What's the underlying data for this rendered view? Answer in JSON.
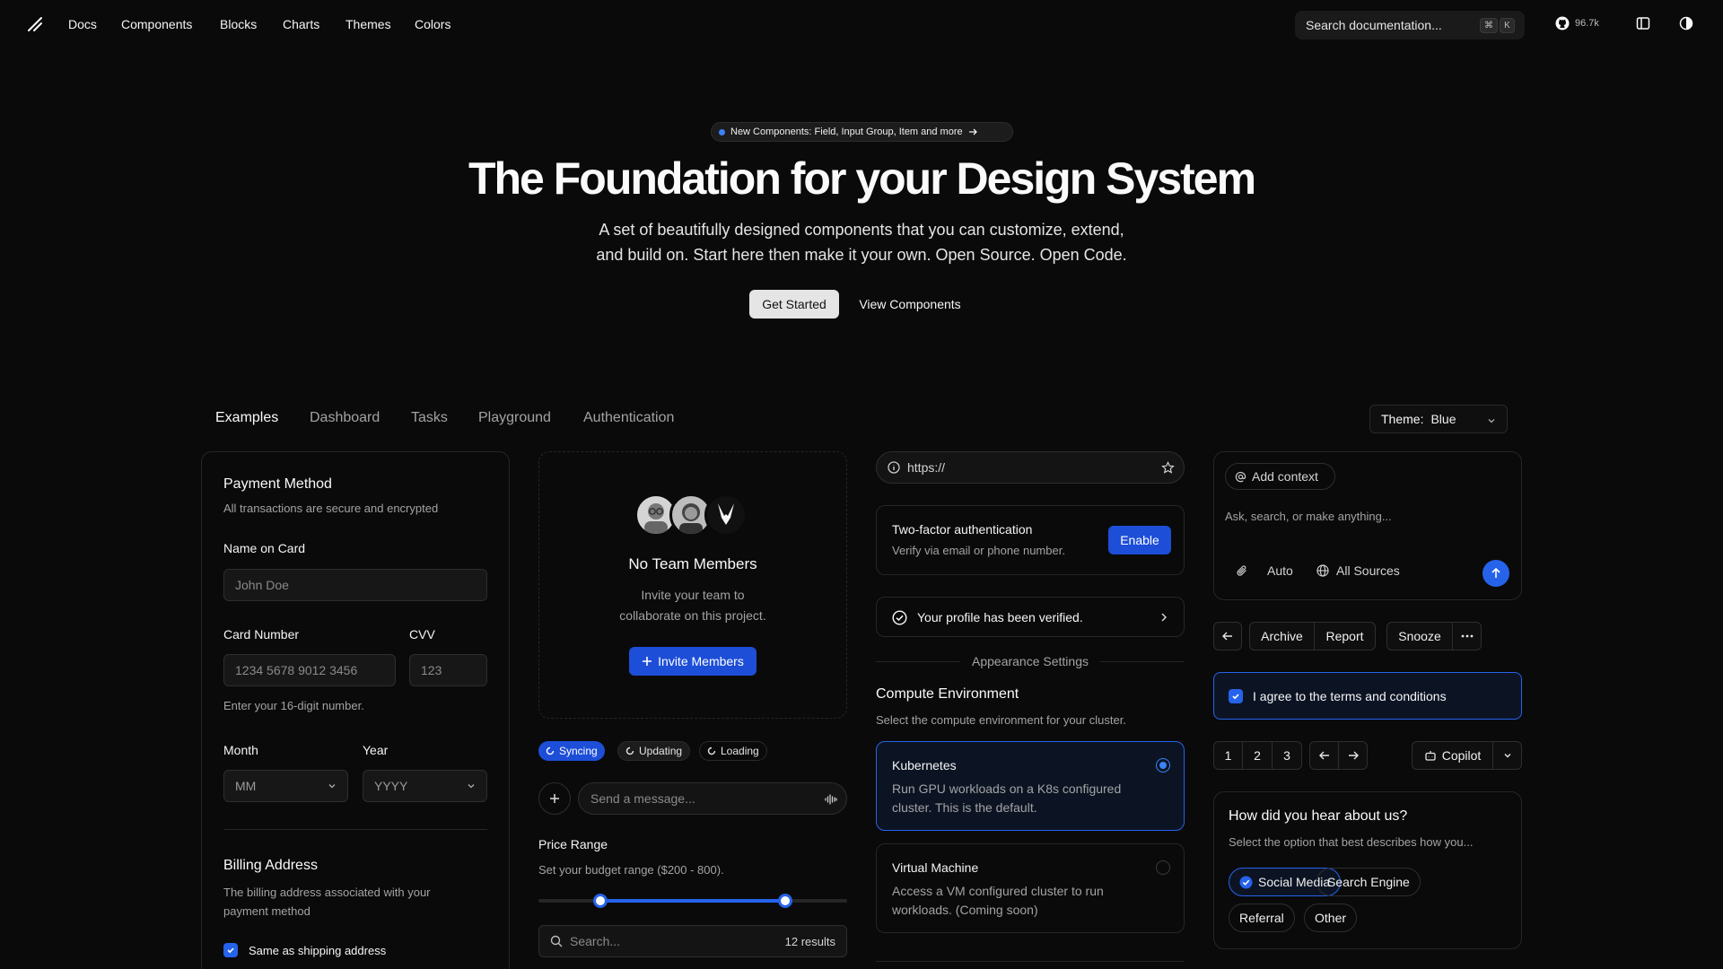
{
  "header": {
    "nav": [
      "Docs",
      "Components",
      "Blocks",
      "Charts",
      "Themes",
      "Colors"
    ],
    "search_placeholder": "Search documentation...",
    "kbd_cmd": "⌘",
    "kbd_k": "K",
    "github_stars": "96.7k"
  },
  "hero": {
    "announcement": "New Components: Field, Input Group, Item and more",
    "title": "The Foundation for your Design System",
    "subtitle_line1": "A set of beautifully designed components that you can customize, extend,",
    "subtitle_line2": "and build on. Start here then make it your own. Open Source. Open Code.",
    "primary_cta": "Get Started",
    "secondary_cta": "View Components"
  },
  "tabs": [
    "Examples",
    "Dashboard",
    "Tasks",
    "Playground",
    "Authentication"
  ],
  "theme_select": {
    "label": "Theme:",
    "value": "Blue"
  },
  "payment": {
    "title": "Payment Method",
    "description": "All transactions are secure and encrypted",
    "name_label": "Name on Card",
    "name_placeholder": "John Doe",
    "card_label": "Card Number",
    "card_placeholder": "1234 5678 9012 3456",
    "cvv_label": "CVV",
    "cvv_placeholder": "123",
    "card_hint": "Enter your 16-digit number.",
    "month_label": "Month",
    "month_placeholder": "MM",
    "year_label": "Year",
    "year_placeholder": "YYYY",
    "billing_title": "Billing Address",
    "billing_desc_line1": "The billing address associated with your",
    "billing_desc_line2": "payment method",
    "same_as_shipping": "Same as shipping address"
  },
  "team": {
    "title": "No Team Members",
    "desc_line1": "Invite your team to",
    "desc_line2": "collaborate on this project.",
    "invite_button": "Invite Members"
  },
  "status_pills": [
    "Syncing",
    "Updating",
    "Loading"
  ],
  "message_input_placeholder": "Send a message...",
  "price": {
    "title": "Price Range",
    "description": "Set your budget range ($200 - 800).",
    "range_min": 200,
    "range_max": 800
  },
  "search_field": {
    "placeholder": "Search...",
    "results": "12 results"
  },
  "url_input": {
    "value": "https://"
  },
  "two_factor": {
    "title": "Two-factor authentication",
    "description": "Verify via email or phone number.",
    "button": "Enable"
  },
  "verified": {
    "text": "Your profile has been verified."
  },
  "appearance_label": "Appearance Settings",
  "compute": {
    "title": "Compute Environment",
    "description": "Select the compute environment for your cluster.",
    "options": [
      {
        "title": "Kubernetes",
        "line1": "Run GPU workloads on a K8s configured",
        "line2": "cluster. This is the default."
      },
      {
        "title": "Virtual Machine",
        "line1": "Access a VM configured cluster to run",
        "line2": "workloads. (Coming soon)"
      }
    ]
  },
  "prompt": {
    "add_context": "Add context",
    "placeholder": "Ask, search, or make anything...",
    "mode": "Auto",
    "sources": "All Sources"
  },
  "actions": {
    "archive": "Archive",
    "report": "Report",
    "snooze": "Snooze"
  },
  "terms": {
    "text": "I agree to the terms and conditions"
  },
  "pagination": [
    "1",
    "2",
    "3"
  ],
  "copilot": {
    "label": "Copilot"
  },
  "survey": {
    "title": "How did you hear about us?",
    "description": "Select the option that best describes how you...",
    "options": [
      "Social Media",
      "Search Engine",
      "Referral",
      "Other"
    ]
  },
  "colors": {
    "accent": "#1d4ed8",
    "background": "#0a0a0a",
    "border": "#262626"
  }
}
